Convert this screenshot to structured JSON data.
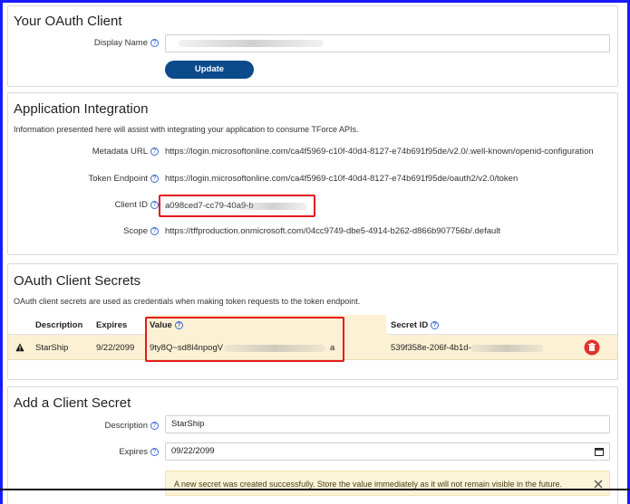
{
  "oauth_client": {
    "title": "Your OAuth Client",
    "display_name_label": "Display Name",
    "display_name_value": "",
    "update_button": "Update"
  },
  "integration": {
    "title": "Application Integration",
    "description": "Information presented here will assist with integrating your application to consume TForce APIs.",
    "metadata_url_label": "Metadata URL",
    "metadata_url": "https://login.microsoftonline.com/ca4f5969-c10f-40d4-8127-e74b691f95de/v2.0/.well-known/openid-configuration",
    "token_endpoint_label": "Token Endpoint",
    "token_endpoint": "https://login.microsoftonline.com/ca4f5969-c10f-40d4-8127-e74b691f95de/oauth2/v2.0/token",
    "client_id_label": "Client ID",
    "client_id": "a098ced7-cc79-40a9-b",
    "scope_label": "Scope",
    "scope": "https://tffproduction.onmicrosoft.com/04cc9749-dbe5-4914-b262-d866b907756b/.default"
  },
  "secrets": {
    "title": "OAuth Client Secrets",
    "description": "OAuth client secrets are used as credentials when making token requests to the token endpoint.",
    "columns": {
      "description": "Description",
      "expires": "Expires",
      "value": "Value",
      "secret_id": "Secret ID"
    },
    "rows": [
      {
        "description": "StarShip",
        "expires": "9/22/2099",
        "value_start": "9ty8Q~sd8l4npogV",
        "value_end": "a",
        "secret_id_start": "539f358e-206f-4b1d-"
      }
    ]
  },
  "add_secret": {
    "title": "Add a Client Secret",
    "description_label": "Description",
    "description_value": "StarShip",
    "expires_label": "Expires",
    "expires_value": "09/22/2099",
    "alert_text": "A new secret was created successfully. Store the value immediately as it will not remain visible in the future."
  },
  "colors": {
    "frame_border": "#1a1aff",
    "primary": "#0b4a8b",
    "highlight_box": "#e41a1a",
    "row_highlight": "#fcf1d4",
    "delete": "#e0332c",
    "link_help": "#3b6bd1"
  },
  "icons": {
    "help": "help-circle-icon",
    "warning": "warning-triangle-icon",
    "delete": "delete-circle-icon",
    "calendar": "calendar-icon",
    "close": "close-icon"
  }
}
